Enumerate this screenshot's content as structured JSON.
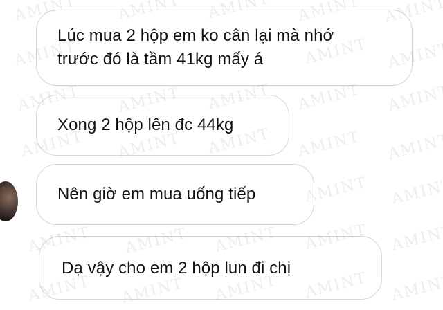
{
  "messages": [
    {
      "lines": [
        "Lúc mua 2 hộp em ko cân lại mà nhớ",
        "trước đó là tầm 41kg mấy á"
      ]
    },
    {
      "lines": [
        "Xong 2 hộp lên đc 44kg"
      ]
    },
    {
      "lines": [
        "Nên giờ em mua uống tiếp"
      ]
    },
    {
      "lines": [
        "Dạ vậy cho em 2 hộp lun đi chị"
      ]
    }
  ],
  "watermark_text": "AMINT"
}
